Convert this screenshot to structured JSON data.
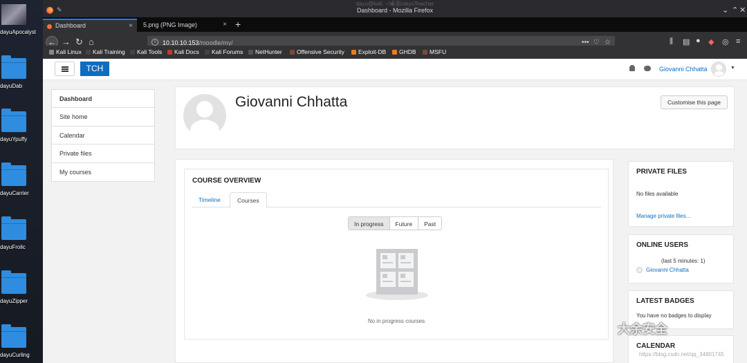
{
  "desktop": {
    "icons": [
      {
        "label": "dayuApocalyst",
        "kind": "thumb"
      },
      {
        "label": "dayuDab",
        "kind": "folder"
      },
      {
        "label": "dayuYpuffy",
        "kind": "folder"
      },
      {
        "label": "dayuCarrier",
        "kind": "folder"
      },
      {
        "label": "dayuFrolic",
        "kind": "folder"
      },
      {
        "label": "dayuZipper",
        "kind": "folder"
      },
      {
        "label": "dayuCurling",
        "kind": "folder"
      }
    ]
  },
  "window": {
    "ghost_title": "dayu@kali: ~/桌面/dayuTeacher",
    "title": "Dashboard - Mozilla Firefox",
    "controls": {
      "minimize": "⌄",
      "maximize": "⌃",
      "close": "✕"
    }
  },
  "tabs": [
    {
      "label": "Dashboard",
      "active": true
    },
    {
      "label": "5.png (PNG Image)",
      "active": false
    }
  ],
  "newtab_label": "+",
  "nav": {
    "back": "←",
    "forward": "→",
    "reload": "↻",
    "home": "⌂",
    "url_host": "10.10.10.153",
    "url_path": "/moodle/my/",
    "url_actions": [
      "•••",
      "♡",
      "☆"
    ],
    "toolbar_icons": [
      "library-icon",
      "sidebar-icon",
      "account-icon",
      "extension-icon",
      "menu-icon"
    ]
  },
  "bookmarks": [
    {
      "label": "Kali Linux",
      "color": "#888888"
    },
    {
      "label": "Kali Training",
      "color": "#444444"
    },
    {
      "label": "Kali Tools",
      "color": "#444444"
    },
    {
      "label": "Kali Docs",
      "color": "#c0392b"
    },
    {
      "label": "Kali Forums",
      "color": "#444444"
    },
    {
      "label": "NetHunter",
      "color": "#555555"
    },
    {
      "label": "Offensive Security",
      "color": "#7a4a3a"
    },
    {
      "label": "Exploit-DB",
      "color": "#e67e22"
    },
    {
      "label": "GHDB",
      "color": "#e67e22"
    },
    {
      "label": "MSFU",
      "color": "#7a4a3a"
    }
  ],
  "moodle": {
    "brand": "TCH",
    "user_name": "Giovanni Chhatta",
    "left_nav": [
      "Dashboard",
      "Site home",
      "Calendar",
      "Private files",
      "My courses"
    ],
    "profile_name": "Giovanni Chhatta",
    "customise_button": "Customise this page",
    "course_overview": {
      "title": "COURSE OVERVIEW",
      "tabs": [
        "Timeline",
        "Courses"
      ],
      "filters": [
        "In progress",
        "Future",
        "Past"
      ],
      "empty_text": "No in progress courses"
    },
    "private_files": {
      "title": "PRIVATE FILES",
      "empty": "No files available",
      "manage_link": "Manage private files..."
    },
    "online_users": {
      "title": "ONLINE USERS",
      "period": "(last 5 minutes: 1)",
      "user": "Giovanni Chhatta"
    },
    "latest_badges": {
      "title": "LATEST BADGES",
      "empty": "You have no badges to display"
    },
    "calendar": {
      "title": "CALENDAR"
    }
  },
  "watermark": {
    "text": "大余安全",
    "url": "https://blog.csdn.net/qq_34801745"
  },
  "colors": {
    "brand_blue": "#0f6cbf",
    "firefox_dark": "#323234",
    "tab_accent": "#0a84ff"
  }
}
